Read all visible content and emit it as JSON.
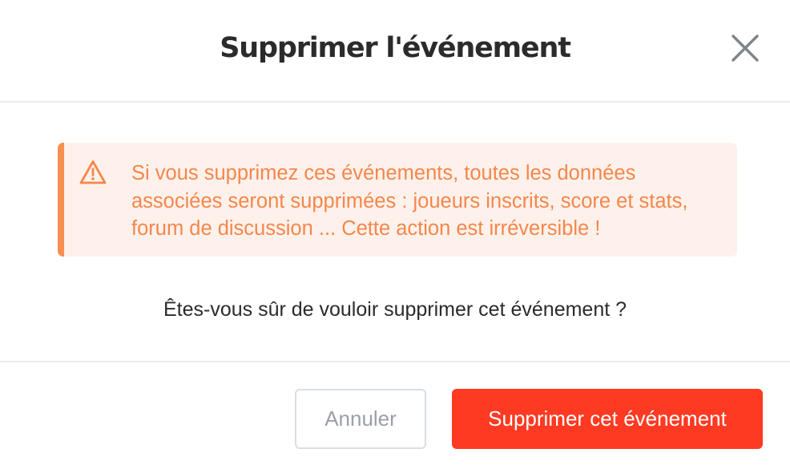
{
  "dialog": {
    "title": "Supprimer l'événement",
    "close_icon": "close-icon"
  },
  "warning": {
    "icon": "warning-triangle-icon",
    "message": "Si vous supprimez ces événements, toutes les données associées seront supprimées : joueurs inscrits, score et stats, forum de discussion ... Cette action est irréversible !",
    "text_color": "#f5874a",
    "background_color": "#fef1ec",
    "accent_color": "#f88e4f"
  },
  "question": "Êtes-vous sûr de vouloir supprimer cet événement ?",
  "actions": {
    "cancel_label": "Annuler",
    "confirm_label": "Supprimer cet événement",
    "confirm_color": "#ff3a22"
  }
}
